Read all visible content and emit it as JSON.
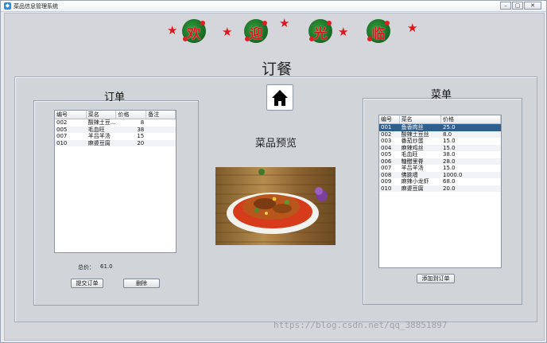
{
  "window": {
    "title": "菜品信息管理系统",
    "buttons": {
      "minimize": "–",
      "maximize": "▢",
      "close": "✕"
    }
  },
  "banner": {
    "characters": [
      "欢",
      "迎",
      "光",
      "临"
    ]
  },
  "page": {
    "title": "订餐"
  },
  "order": {
    "title": "订单",
    "columns": [
      "编号",
      "菜名",
      "价格",
      "备注"
    ],
    "rows": [
      [
        "002",
        "酸辣土豆...",
        "8",
        ""
      ],
      [
        "005",
        "毛血旺",
        "38",
        ""
      ],
      [
        "007",
        "羊吕羊汤",
        "15",
        ""
      ],
      [
        "010",
        "麻婆豆腐",
        "20",
        ""
      ]
    ],
    "total_label": "总价：",
    "total_value": "61.0",
    "submit_button": "提交订单",
    "delete_button": "删除"
  },
  "preview": {
    "label": "菜品预览",
    "home_icon": "home-icon"
  },
  "menu": {
    "title": "菜单",
    "columns": [
      "编号",
      "菜名",
      "价格"
    ],
    "rows": [
      [
        "001",
        "鱼香肉丝",
        "25.0"
      ],
      [
        "002",
        "酸辣土豆丝",
        "8.0"
      ],
      [
        "003",
        "番茄炒蛋",
        "15.0"
      ],
      [
        "004",
        "麻辣鸡丝",
        "15.0"
      ],
      [
        "005",
        "毛血旺",
        "38.0"
      ],
      [
        "006",
        "糖醋里脊",
        "28.0"
      ],
      [
        "007",
        "羊吕羊汤",
        "15.0"
      ],
      [
        "008",
        "佛跳墙",
        "1000.0"
      ],
      [
        "009",
        "麻辣小龙虾",
        "68.0"
      ],
      [
        "010",
        "麻婆豆腐",
        "20.0"
      ]
    ],
    "selected_row": 0,
    "add_button": "添加到订单"
  },
  "watermark": "https://blog.csdn.net/qq_38851897",
  "colors": {
    "selection": "#2f5f8f",
    "banner_red": "#d7191f",
    "holly_green": "#1c6f27"
  }
}
